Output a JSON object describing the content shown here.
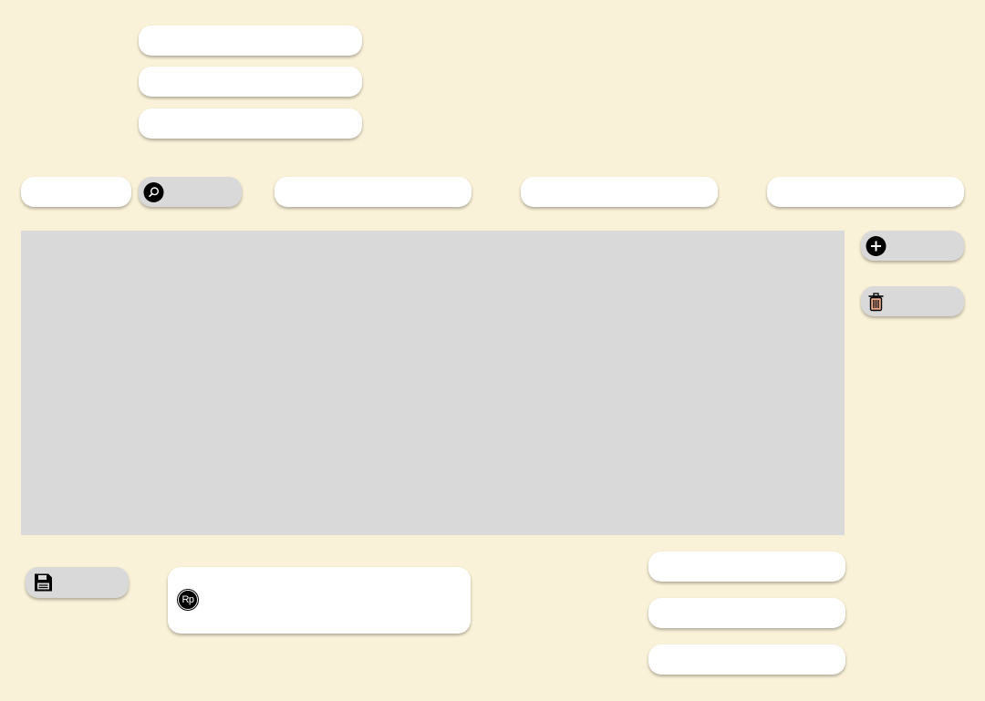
{
  "colors": {
    "background": "#FAF2D8",
    "field": "#FFFFFF",
    "button": "#D9D9D9",
    "panel": "#D9D9D9",
    "trash": "#E9A98B"
  },
  "top_fields": [
    {
      "value": ""
    },
    {
      "value": ""
    },
    {
      "value": ""
    }
  ],
  "filter_bar": {
    "field_1": "",
    "search_button_label": "",
    "field_2": "",
    "field_3": "",
    "field_4": ""
  },
  "side_actions": {
    "add_label": "",
    "delete_label": ""
  },
  "bottom": {
    "save_label": "",
    "card_avatar_initials": "Rp",
    "card_text": "",
    "right_fields": [
      {
        "value": ""
      },
      {
        "value": ""
      },
      {
        "value": ""
      }
    ]
  },
  "icons": {
    "search": "search-icon",
    "add": "plus-circle-icon",
    "delete": "trash-icon",
    "save": "floppy-disk-icon",
    "avatar": "avatar-icon"
  }
}
